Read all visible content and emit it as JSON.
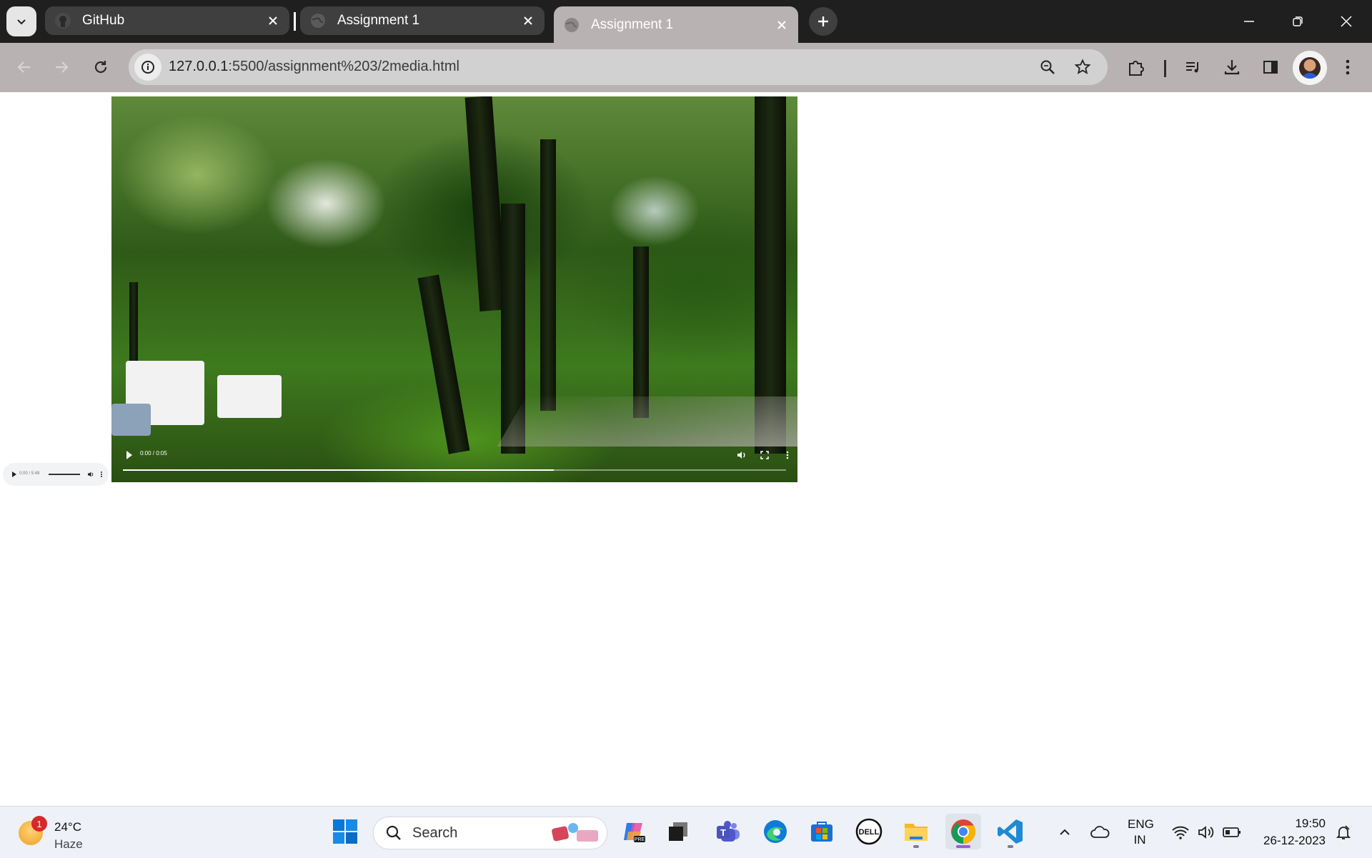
{
  "browser": {
    "tabs": [
      {
        "title": "GitHub",
        "favicon": "github-icon",
        "active": false
      },
      {
        "title": "Assignment 1",
        "favicon": "globe-icon",
        "active": false
      },
      {
        "title": "Assignment 1",
        "favicon": "globe-icon",
        "active": true
      }
    ],
    "url_host": "127.0.0.1",
    "url_path": ":5500/assignment%203/2media.html"
  },
  "page": {
    "video": {
      "time": "0:00 / 0:05",
      "progress": 0.65
    },
    "audio": {
      "time": "0:00 / 5:48",
      "volume": 1.0
    }
  },
  "taskbar": {
    "weather": {
      "badge": "1",
      "temp": "24°C",
      "condition": "Haze"
    },
    "search_label": "Search",
    "language": {
      "line1": "ENG",
      "line2": "IN"
    },
    "clock": {
      "time": "19:50",
      "date": "26-12-2023"
    }
  },
  "colors": {
    "tabstrip": "#1f1f1f",
    "active_tab": "#b9b2b2",
    "toolbar": "#b9b2b2",
    "taskbar": "#eef1f7",
    "chrome_active_indicator": "#9b5cd6"
  }
}
